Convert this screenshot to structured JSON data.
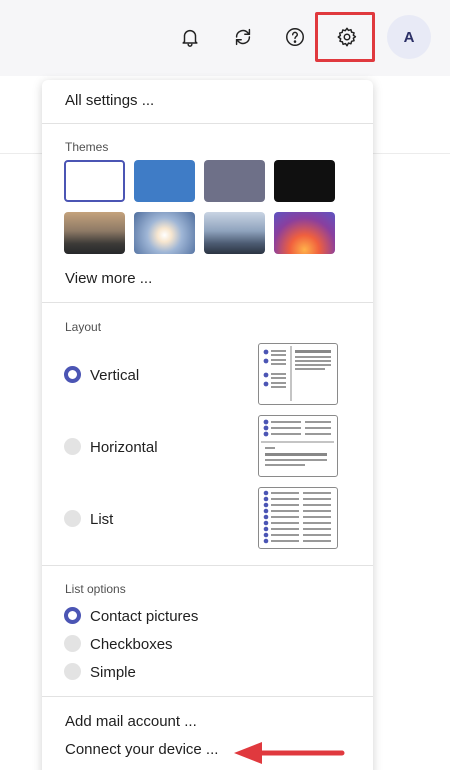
{
  "header": {
    "avatar_initial": "A",
    "icons": [
      "bell-icon",
      "sync-icon",
      "help-icon",
      "gear-icon"
    ]
  },
  "settings": {
    "all_settings": "All settings ...",
    "themes": {
      "title": "Themes",
      "view_more": "View more ...",
      "swatches": [
        "white",
        "blue",
        "slate",
        "black",
        "mountains",
        "sunrise",
        "city",
        "sunset-glow"
      ],
      "selected": "white"
    },
    "layout": {
      "title": "Layout",
      "options": [
        "Vertical",
        "Horizontal",
        "List"
      ],
      "selected": "Vertical"
    },
    "list_options": {
      "title": "List options",
      "options": [
        "Contact pictures",
        "Checkboxes",
        "Simple"
      ],
      "selected": "Contact pictures"
    },
    "add_mail_account": "Add mail account ...",
    "connect_device": "Connect your device ..."
  },
  "colors": {
    "accent": "#4b55b4",
    "highlight": "#e0393e"
  }
}
